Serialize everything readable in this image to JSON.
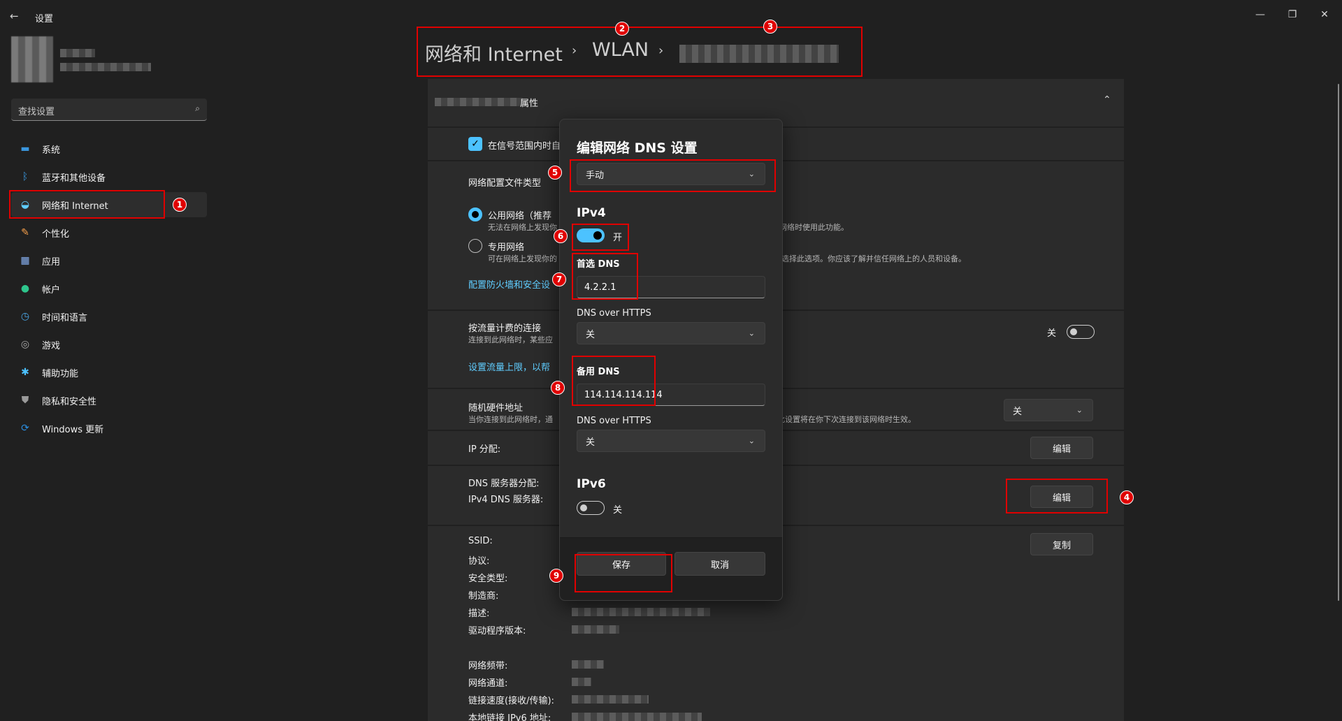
{
  "window": {
    "title": "设置",
    "back_icon": "←",
    "minimize_icon": "—",
    "restore_icon": "❐",
    "close_icon": "✕"
  },
  "sidebar": {
    "search_placeholder": "查找设置",
    "search_icon": "⌕",
    "items": [
      {
        "label": "系统",
        "icon": "▬",
        "color": "#3a96dd"
      },
      {
        "label": "蓝牙和其他设备",
        "icon": "ᛒ",
        "color": "#3a96dd"
      },
      {
        "label": "网络和 Internet",
        "icon": "◒",
        "color": "#60cdff"
      },
      {
        "label": "个性化",
        "icon": "✎",
        "color": "#f7a04b"
      },
      {
        "label": "应用",
        "icon": "▦",
        "color": "#8ab4f8"
      },
      {
        "label": "帐户",
        "icon": "●",
        "color": "#2ec58c"
      },
      {
        "label": "时间和语言",
        "icon": "◷",
        "color": "#4aa8e8"
      },
      {
        "label": "游戏",
        "icon": "◎",
        "color": "#aaaaaa"
      },
      {
        "label": "辅助功能",
        "icon": "✱",
        "color": "#4cc2ff"
      },
      {
        "label": "隐私和安全性",
        "icon": "⛊",
        "color": "#9a9a9a"
      },
      {
        "label": "Windows 更新",
        "icon": "⟳",
        "color": "#2a8ee0"
      }
    ]
  },
  "breadcrumb": {
    "part1": "网络和 Internet",
    "sep": "›",
    "part2": "WLAN"
  },
  "content": {
    "properties_suffix": "属性",
    "collapse_icon": "⌃",
    "auto_connect_label": "在信号范围内时自",
    "profile_type_label": "网络配置文件类型",
    "public_label": "公用网络（推荐",
    "public_desc": "无法在网络上发现你",
    "public_desc_tail": "网络时使用此功能。",
    "private_label": "专用网络",
    "private_desc": "可在网络上发现你的",
    "private_desc_tail": "选择此选项。你应该了解并信任网络上的人员和设备。",
    "firewall_link": "配置防火墙和安全设",
    "metered_label": "按流量计费的连接",
    "metered_desc": "连接到此网络时，某些应",
    "metered_state": "关",
    "data_limit_link": "设置流量上限，以帮",
    "random_hw_label": "随机硬件地址",
    "random_hw_desc": "当你连接到此网络时，通",
    "random_hw_desc_tail": "此设置将在你下次连接到该网络时生效。",
    "random_hw_value": "关",
    "ip_assign_label": "IP 分配:",
    "edit_label": "编辑",
    "dns_assign_label": "DNS 服务器分配:",
    "ipv4_dns_label": "IPv4 DNS 服务器:",
    "copy_label": "复制",
    "details": [
      "SSID:",
      "协议:",
      "安全类型:",
      "制造商:",
      "描述:",
      "驱动程序版本:",
      "网络频带:",
      "网络通道:",
      "链接速度(接收/传输):",
      "本地链接 IPv6 地址:"
    ]
  },
  "dialog": {
    "title": "编辑网络 DNS 设置",
    "mode": "手动",
    "ipv4_title": "IPv4",
    "ipv4_state": "开",
    "preferred_dns_label": "首选 DNS",
    "preferred_dns_value": "4.2.2.1",
    "doh_label_1": "DNS over HTTPS",
    "doh_value_1": "关",
    "alternate_dns_label": "备用 DNS",
    "alternate_dns_value": "114.114.114.114",
    "doh_label_2": "DNS over HTTPS",
    "doh_value_2": "关",
    "ipv6_title": "IPv6",
    "ipv6_state": "关",
    "save_label": "保存",
    "cancel_label": "取消",
    "chevron_icon": "⌄"
  },
  "annotations": [
    "1",
    "2",
    "3",
    "4",
    "5",
    "6",
    "7",
    "8",
    "9"
  ],
  "colors": {
    "accent": "#4cc2ff",
    "annotation_red": "#e00000",
    "background": "#202020"
  }
}
